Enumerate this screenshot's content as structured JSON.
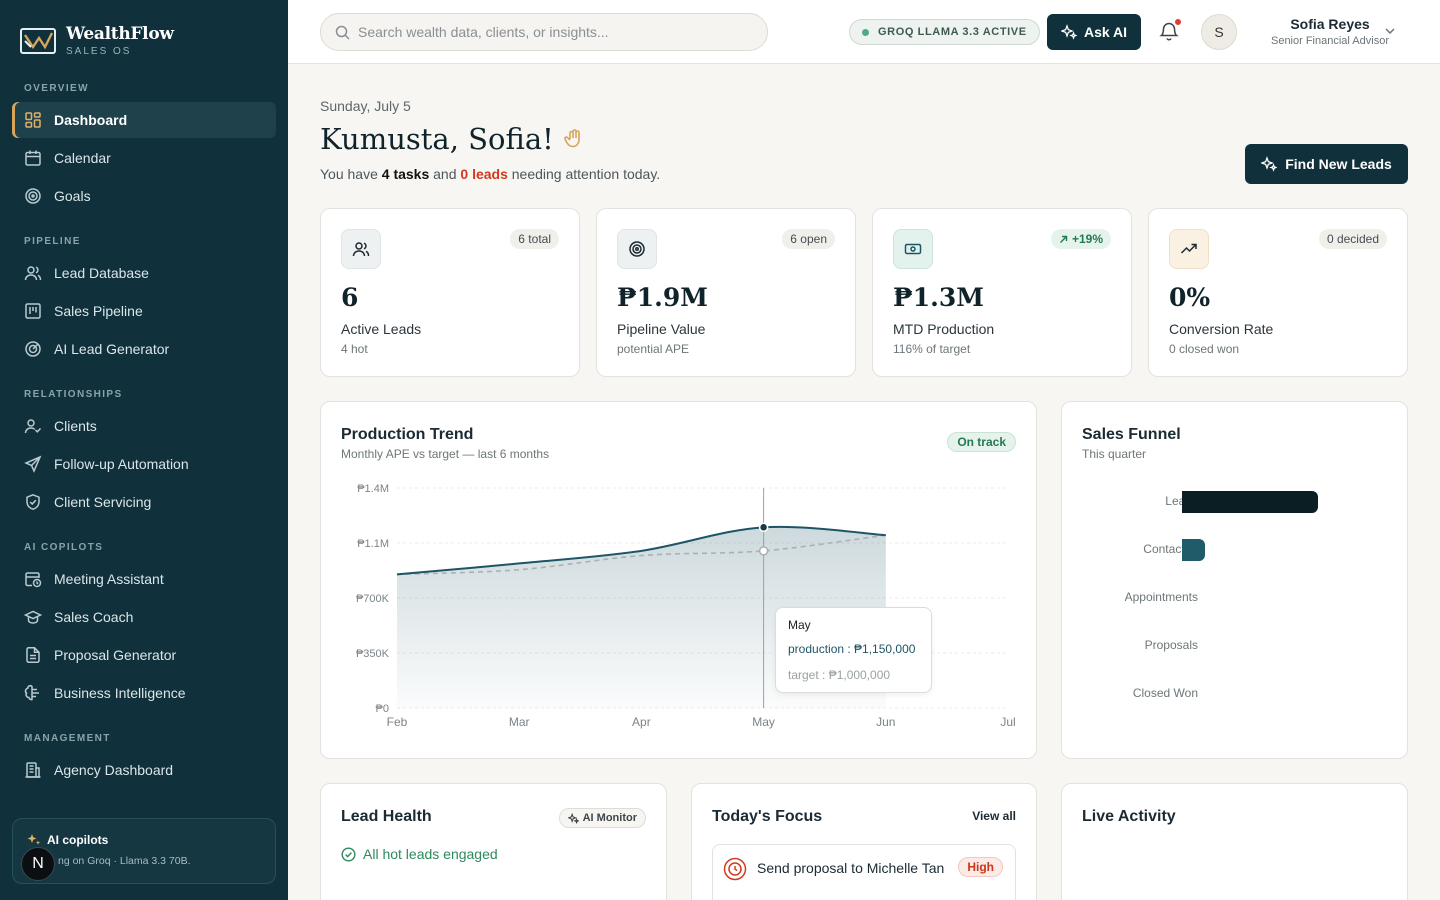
{
  "brand": {
    "name": "WealthFlow",
    "tagline": "SALES OS"
  },
  "sidebar": {
    "sections": {
      "overview": "OVERVIEW",
      "pipeline": "PIPELINE",
      "relationships": "RELATIONSHIPS",
      "ai_copilots": "AI COPILOTS",
      "management": "MANAGEMENT"
    },
    "items": {
      "dashboard": "Dashboard",
      "calendar": "Calendar",
      "goals": "Goals",
      "lead_database": "Lead Database",
      "sales_pipeline": "Sales Pipeline",
      "ai_lead_generator": "AI Lead Generator",
      "clients": "Clients",
      "follow_up": "Follow-up Automation",
      "client_servicing": "Client Servicing",
      "meeting_assistant": "Meeting Assistant",
      "sales_coach": "Sales Coach",
      "proposal_generator": "Proposal Generator",
      "business_intelligence": "Business Intelligence",
      "agency_dashboard": "Agency Dashboard"
    },
    "active": "dashboard",
    "copilot": {
      "title": "AI copilots",
      "desc": "ng on Groq · Llama 3.3 70B.",
      "badge": "N"
    }
  },
  "topbar": {
    "search_placeholder": "Search wealth data, clients, or insights...",
    "model_status": "GROQ LLAMA 3.3 ACTIVE",
    "ask_ai": "Ask AI",
    "user": {
      "initial": "S",
      "name": "Sofia Reyes",
      "role": "Senior Financial Advisor"
    }
  },
  "header": {
    "date": "Sunday, July 5",
    "greeting": "Kumusta, Sofia!",
    "sub_pre": "You have ",
    "sub_tasks": "4 tasks",
    "sub_mid": " and ",
    "sub_leads": "0 leads",
    "sub_post": " needing attention today.",
    "find_leads": "Find New Leads"
  },
  "kpis": [
    {
      "pill": "6 total",
      "value": "6",
      "label": "Active Leads",
      "hint": "4 hot"
    },
    {
      "pill": "6 open",
      "value": "₱1.9M",
      "label": "Pipeline Value",
      "hint": "potential APE"
    },
    {
      "pill": "+19%",
      "value": "₱1.3M",
      "label": "MTD Production",
      "hint": "116% of target"
    },
    {
      "pill": "0 decided",
      "value": "0%",
      "label": "Conversion Rate",
      "hint": "0 closed won"
    }
  ],
  "trend": {
    "title": "Production Trend",
    "subtitle": "Monthly APE vs target — last 6 months",
    "status": "On track",
    "tooltip": {
      "month": "May",
      "production": "production : ₱1,150,000",
      "target": "target : ₱1,000,000"
    }
  },
  "chart_data": {
    "type": "area",
    "x": [
      "Feb",
      "Mar",
      "Apr",
      "May",
      "Jun",
      "Jul"
    ],
    "yticks": [
      "₱0",
      "₱350K",
      "₱700K",
      "₱1.1M",
      "₱1.4M"
    ],
    "ylim": [
      0,
      1400000
    ],
    "series": [
      {
        "name": "production",
        "values": [
          850000,
          920000,
          1000000,
          1150000,
          1100000
        ],
        "color": "#1e5566"
      },
      {
        "name": "target",
        "values": [
          850000,
          880000,
          970000,
          1000000,
          1100000
        ],
        "color": "#a9b1b4"
      }
    ],
    "highlight": "May"
  },
  "funnel": {
    "title": "Sales Funnel",
    "subtitle": "This quarter",
    "stages": [
      {
        "label": "Leads",
        "value": 6,
        "color": "#0b1e24"
      },
      {
        "label": "Contacted",
        "value": 1,
        "color": "#1f5b68"
      },
      {
        "label": "Appointments",
        "value": 0,
        "color": "#1f5b68"
      },
      {
        "label": "Proposals",
        "value": 0,
        "color": "#1f5b68"
      },
      {
        "label": "Closed Won",
        "value": 0,
        "color": "#1f5b68"
      }
    ]
  },
  "lead_health": {
    "title": "Lead Health",
    "badge": "AI Monitor",
    "status": "All hot leads engaged"
  },
  "focus": {
    "title": "Today's Focus",
    "view_all": "View all",
    "task": "Send proposal to Michelle Tan",
    "priority": "High"
  },
  "activity": {
    "title": "Live Activity"
  }
}
